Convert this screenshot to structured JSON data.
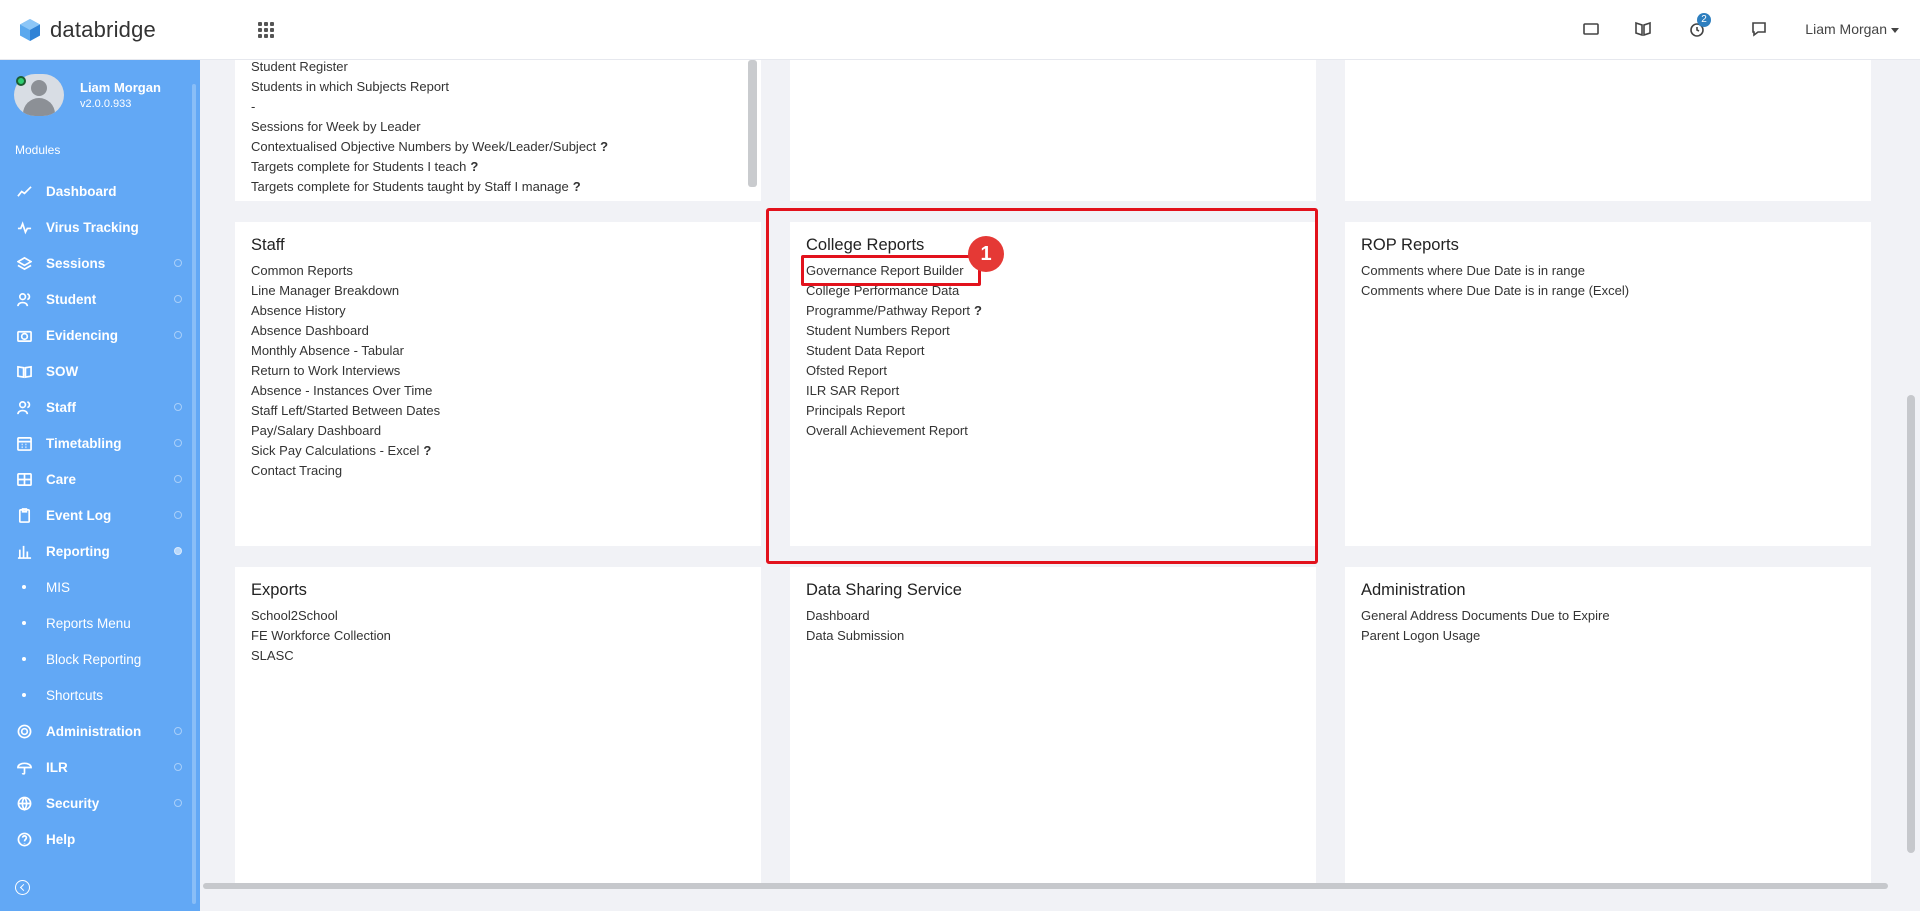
{
  "app": {
    "brand": "databridge",
    "user_name": "Liam Morgan",
    "notifications_count": "2"
  },
  "sidebar": {
    "profile_name": "Liam Morgan",
    "profile_version": "v2.0.0.933",
    "modules_label": "Modules",
    "items": [
      {
        "label": "Dashboard",
        "icon": "chart-line-icon"
      },
      {
        "label": "Virus Tracking",
        "icon": "pulse-icon"
      },
      {
        "label": "Sessions",
        "icon": "layers-icon"
      },
      {
        "label": "Student",
        "icon": "users-icon"
      },
      {
        "label": "Evidencing",
        "icon": "camera-icon"
      },
      {
        "label": "SOW",
        "icon": "book-open-icon"
      },
      {
        "label": "Staff",
        "icon": "users-icon"
      },
      {
        "label": "Timetabling",
        "icon": "calendar-icon"
      },
      {
        "label": "Care",
        "icon": "grid-icon"
      },
      {
        "label": "Event Log",
        "icon": "clipboard-icon"
      },
      {
        "label": "Reporting",
        "icon": "bar-chart-icon"
      }
    ],
    "reporting_sub": [
      "MIS",
      "Reports Menu",
      "Block Reporting",
      "Shortcuts"
    ],
    "bottom_items": [
      {
        "label": "Administration",
        "icon": "gear-icon"
      },
      {
        "label": "ILR",
        "icon": "umbrella-icon"
      },
      {
        "label": "Security",
        "icon": "globe-icon"
      },
      {
        "label": "Help",
        "icon": "help-icon"
      }
    ]
  },
  "cards": {
    "top_left_links": [
      {
        "text": "Student Register",
        "q": ""
      },
      {
        "text": "Students in which Subjects Report",
        "q": ""
      },
      {
        "text": "-",
        "q": ""
      },
      {
        "text": "Sessions for Week by Leader",
        "q": ""
      },
      {
        "text": "Contextualised Objective Numbers by Week/Leader/Subject",
        "q": "?"
      },
      {
        "text": "Targets complete for Students I teach",
        "q": "?"
      },
      {
        "text": "Targets complete for Students taught by Staff I manage",
        "q": "?"
      }
    ],
    "staff": {
      "title": "Staff",
      "links": [
        {
          "text": "Common Reports",
          "q": ""
        },
        {
          "text": "Line Manager Breakdown",
          "q": ""
        },
        {
          "text": "Absence History",
          "q": ""
        },
        {
          "text": "Absence Dashboard",
          "q": ""
        },
        {
          "text": "Monthly Absence - Tabular",
          "q": ""
        },
        {
          "text": "Return to Work Interviews",
          "q": ""
        },
        {
          "text": "Absence - Instances Over Time",
          "q": ""
        },
        {
          "text": "Staff Left/Started Between Dates",
          "q": ""
        },
        {
          "text": "Pay/Salary Dashboard",
          "q": ""
        },
        {
          "text": "Sick Pay Calculations - Excel",
          "q": "?"
        },
        {
          "text": "Contact Tracing",
          "q": ""
        }
      ]
    },
    "college": {
      "title": "College Reports",
      "links": [
        {
          "text": "Governance Report Builder",
          "q": ""
        },
        {
          "text": "College Performance Data",
          "q": ""
        },
        {
          "text": "Programme/Pathway Report",
          "q": "?"
        },
        {
          "text": "Student Numbers Report",
          "q": ""
        },
        {
          "text": "Student Data Report",
          "q": ""
        },
        {
          "text": "Ofsted Report",
          "q": ""
        },
        {
          "text": "ILR SAR Report",
          "q": ""
        },
        {
          "text": "Principals Report",
          "q": ""
        },
        {
          "text": "Overall Achievement Report",
          "q": ""
        }
      ]
    },
    "rop": {
      "title": "ROP Reports",
      "links": [
        {
          "text": "Comments where Due Date is in range",
          "q": ""
        },
        {
          "text": "Comments where Due Date is in range (Excel)",
          "q": ""
        }
      ]
    },
    "exports": {
      "title": "Exports",
      "links": [
        {
          "text": "School2School",
          "q": ""
        },
        {
          "text": "FE Workforce Collection",
          "q": ""
        },
        {
          "text": "SLASC",
          "q": ""
        }
      ]
    },
    "dss": {
      "title": "Data Sharing Service",
      "links": [
        {
          "text": "Dashboard",
          "q": ""
        },
        {
          "text": "Data Submission",
          "q": ""
        }
      ]
    },
    "admin": {
      "title": "Administration",
      "links": [
        {
          "text": "General Address Documents Due to Expire",
          "q": ""
        },
        {
          "text": "Parent Logon Usage",
          "q": ""
        }
      ]
    }
  },
  "annotation": {
    "marker_label": "1",
    "accent_color": "#e2121c"
  },
  "colors": {
    "sidebar_bg": "#62a8f5",
    "page_bg": "#f1f2f6",
    "badge": "#2e7fbf"
  }
}
